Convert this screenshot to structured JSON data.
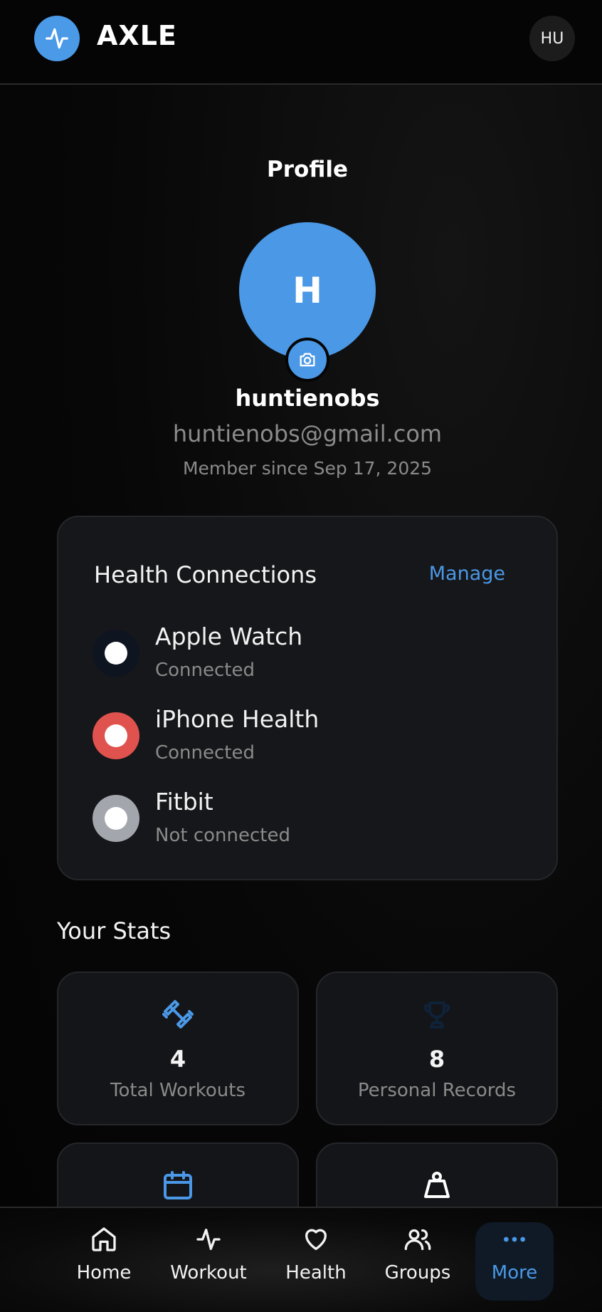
{
  "header": {
    "brand": "AXLE",
    "user_initials": "HU"
  },
  "profile": {
    "title": "Profile",
    "avatar_initial": "H",
    "username": "huntienobs",
    "email": "huntienobs@gmail.com",
    "member_since": "Member since Sep 17, 2025"
  },
  "health_connections": {
    "title": "Health Connections",
    "manage_label": "Manage",
    "devices": [
      {
        "name": "Apple Watch",
        "status": "Connected",
        "color": "#0e1420"
      },
      {
        "name": "iPhone Health",
        "status": "Connected",
        "color": "#e0524e"
      },
      {
        "name": "Fitbit",
        "status": "Not connected",
        "color": "#a4a6ae"
      }
    ]
  },
  "stats": {
    "title": "Your Stats",
    "items": [
      {
        "value": "4",
        "label": "Total Workouts",
        "icon": "dumbbell-icon"
      },
      {
        "value": "8",
        "label": "Personal Records",
        "icon": "trophy-icon"
      },
      {
        "icon": "calendar-icon"
      },
      {
        "icon": "weight-icon"
      }
    ]
  },
  "nav": {
    "items": [
      {
        "label": "Home",
        "icon": "home-icon"
      },
      {
        "label": "Workout",
        "icon": "activity-icon"
      },
      {
        "label": "Health",
        "icon": "heart-icon"
      },
      {
        "label": "Groups",
        "icon": "users-icon"
      },
      {
        "label": "More",
        "icon": "more-icon",
        "active": true
      }
    ]
  },
  "colors": {
    "accent": "#4a98e6",
    "background": "#050505",
    "card": "#16171a"
  }
}
